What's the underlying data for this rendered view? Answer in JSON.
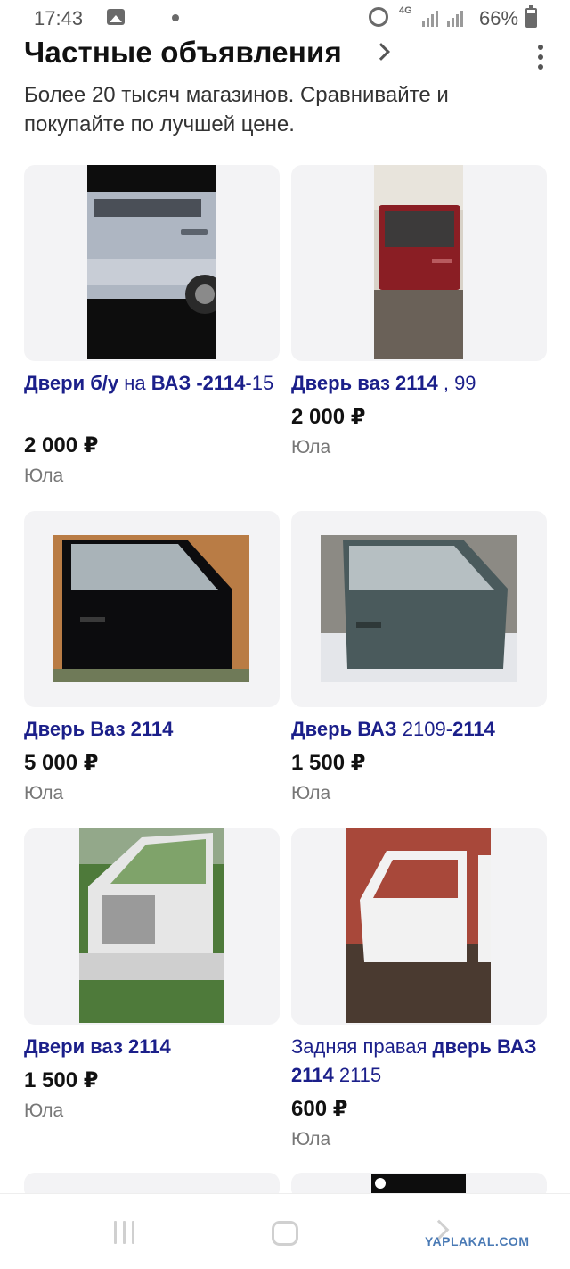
{
  "status_bar": {
    "time": "17:43",
    "network": "4G",
    "battery": "66%"
  },
  "section": {
    "title": "Частные объявления",
    "subtitle": "Более 20 тысяч магазинов. Сравнивайте и покупайте по лучшей цене."
  },
  "listings": [
    {
      "title_bold_1": "Двери б/у",
      "title_plain_1": " на ",
      "title_bold_2": "ВАЗ -2114",
      "title_plain_2": "-15",
      "price": "2 000 ₽",
      "seller": "Юла"
    },
    {
      "title_bold_1": "Дверь ваз 2114",
      "title_plain_1": " , 99",
      "price": "2 000 ₽",
      "seller": "Юла"
    },
    {
      "title_bold_1": "Дверь Ваз 2114",
      "price": "5 000 ₽",
      "seller": "Юла"
    },
    {
      "title_bold_1": "Дверь ВАЗ",
      "title_plain_1": " 2109-",
      "title_bold_2": "2114",
      "price": "1 500 ₽",
      "seller": "Юла"
    },
    {
      "title_bold_1": "Двери ваз 2114",
      "price": "1 500 ₽",
      "seller": "Юла"
    },
    {
      "title_plain_1": "Задняя правая ",
      "title_bold_1": "дверь ВАЗ 2114",
      "title_plain_2": " 2115",
      "price": "600 ₽",
      "seller": "Юла"
    }
  ],
  "watermark": "YAPLAKAL.COM",
  "colors": {
    "title_link": "#1b1f8a",
    "card_bg": "#f3f3f5"
  }
}
